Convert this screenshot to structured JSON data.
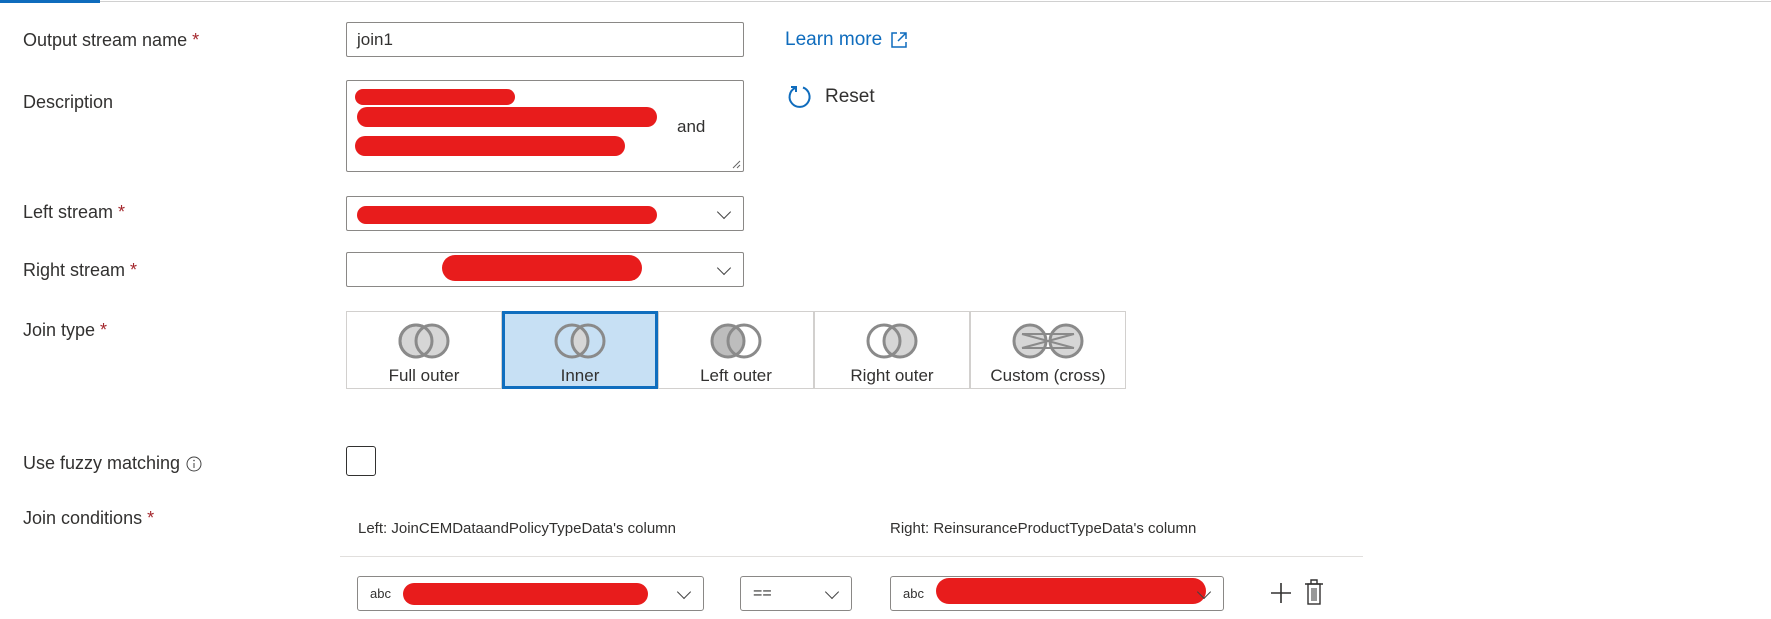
{
  "form": {
    "output_stream_name": {
      "label": "Output stream name",
      "required": "*",
      "value": "join1"
    },
    "learn_more": "Learn more",
    "description": {
      "label": "Description",
      "visible_fragment": "and"
    },
    "reset": "Reset",
    "left_stream": {
      "label": "Left stream",
      "required": "*"
    },
    "right_stream": {
      "label": "Right stream",
      "required": "*"
    },
    "join_type": {
      "label": "Join type",
      "required": "*",
      "selected": "Inner",
      "options": [
        "Full outer",
        "Inner",
        "Left outer",
        "Right outer",
        "Custom (cross)"
      ]
    },
    "fuzzy": {
      "label": "Use fuzzy matching",
      "checked": false
    },
    "join_conditions": {
      "label": "Join conditions",
      "required": "*",
      "left_header": "Left: JoinCEMDataandPolicyTypeData's column",
      "right_header": "Right: ReinsuranceProductTypeData's column",
      "rows": [
        {
          "left_type": "abc",
          "operator": "==",
          "right_type": "abc"
        }
      ]
    }
  },
  "colors": {
    "accent": "#0f6cbd",
    "selected_bg": "#c7e0f4",
    "required": "#a4262c",
    "redaction": "#e81c1c"
  }
}
